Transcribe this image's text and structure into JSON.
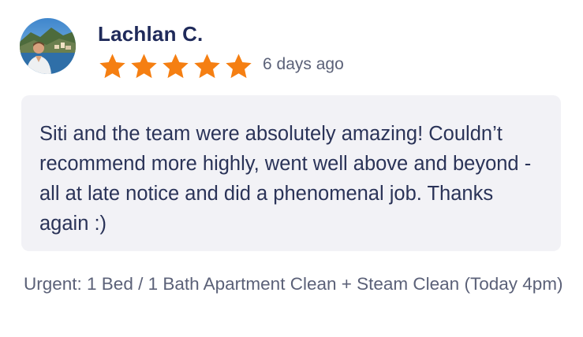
{
  "review": {
    "reviewer_name": "Lachlan C.",
    "rating": 5,
    "max_rating": 5,
    "date": "6 days ago",
    "text": "Siti and the team were absolutely amazing! Couldn’t recommend more highly, went well above and beyond - all at late notice and did a phenomenal job. Thanks again :)",
    "service": "Urgent: 1 Bed / 1 Bath Apartment Clean + Steam Clean (Today 4pm)"
  },
  "colors": {
    "name": "#1f2a5a",
    "star": "#f57f12",
    "review_box_bg": "#f2f2f6",
    "muted_text": "#5b6178"
  },
  "icons": {
    "star": "star-icon",
    "avatar": "avatar"
  }
}
